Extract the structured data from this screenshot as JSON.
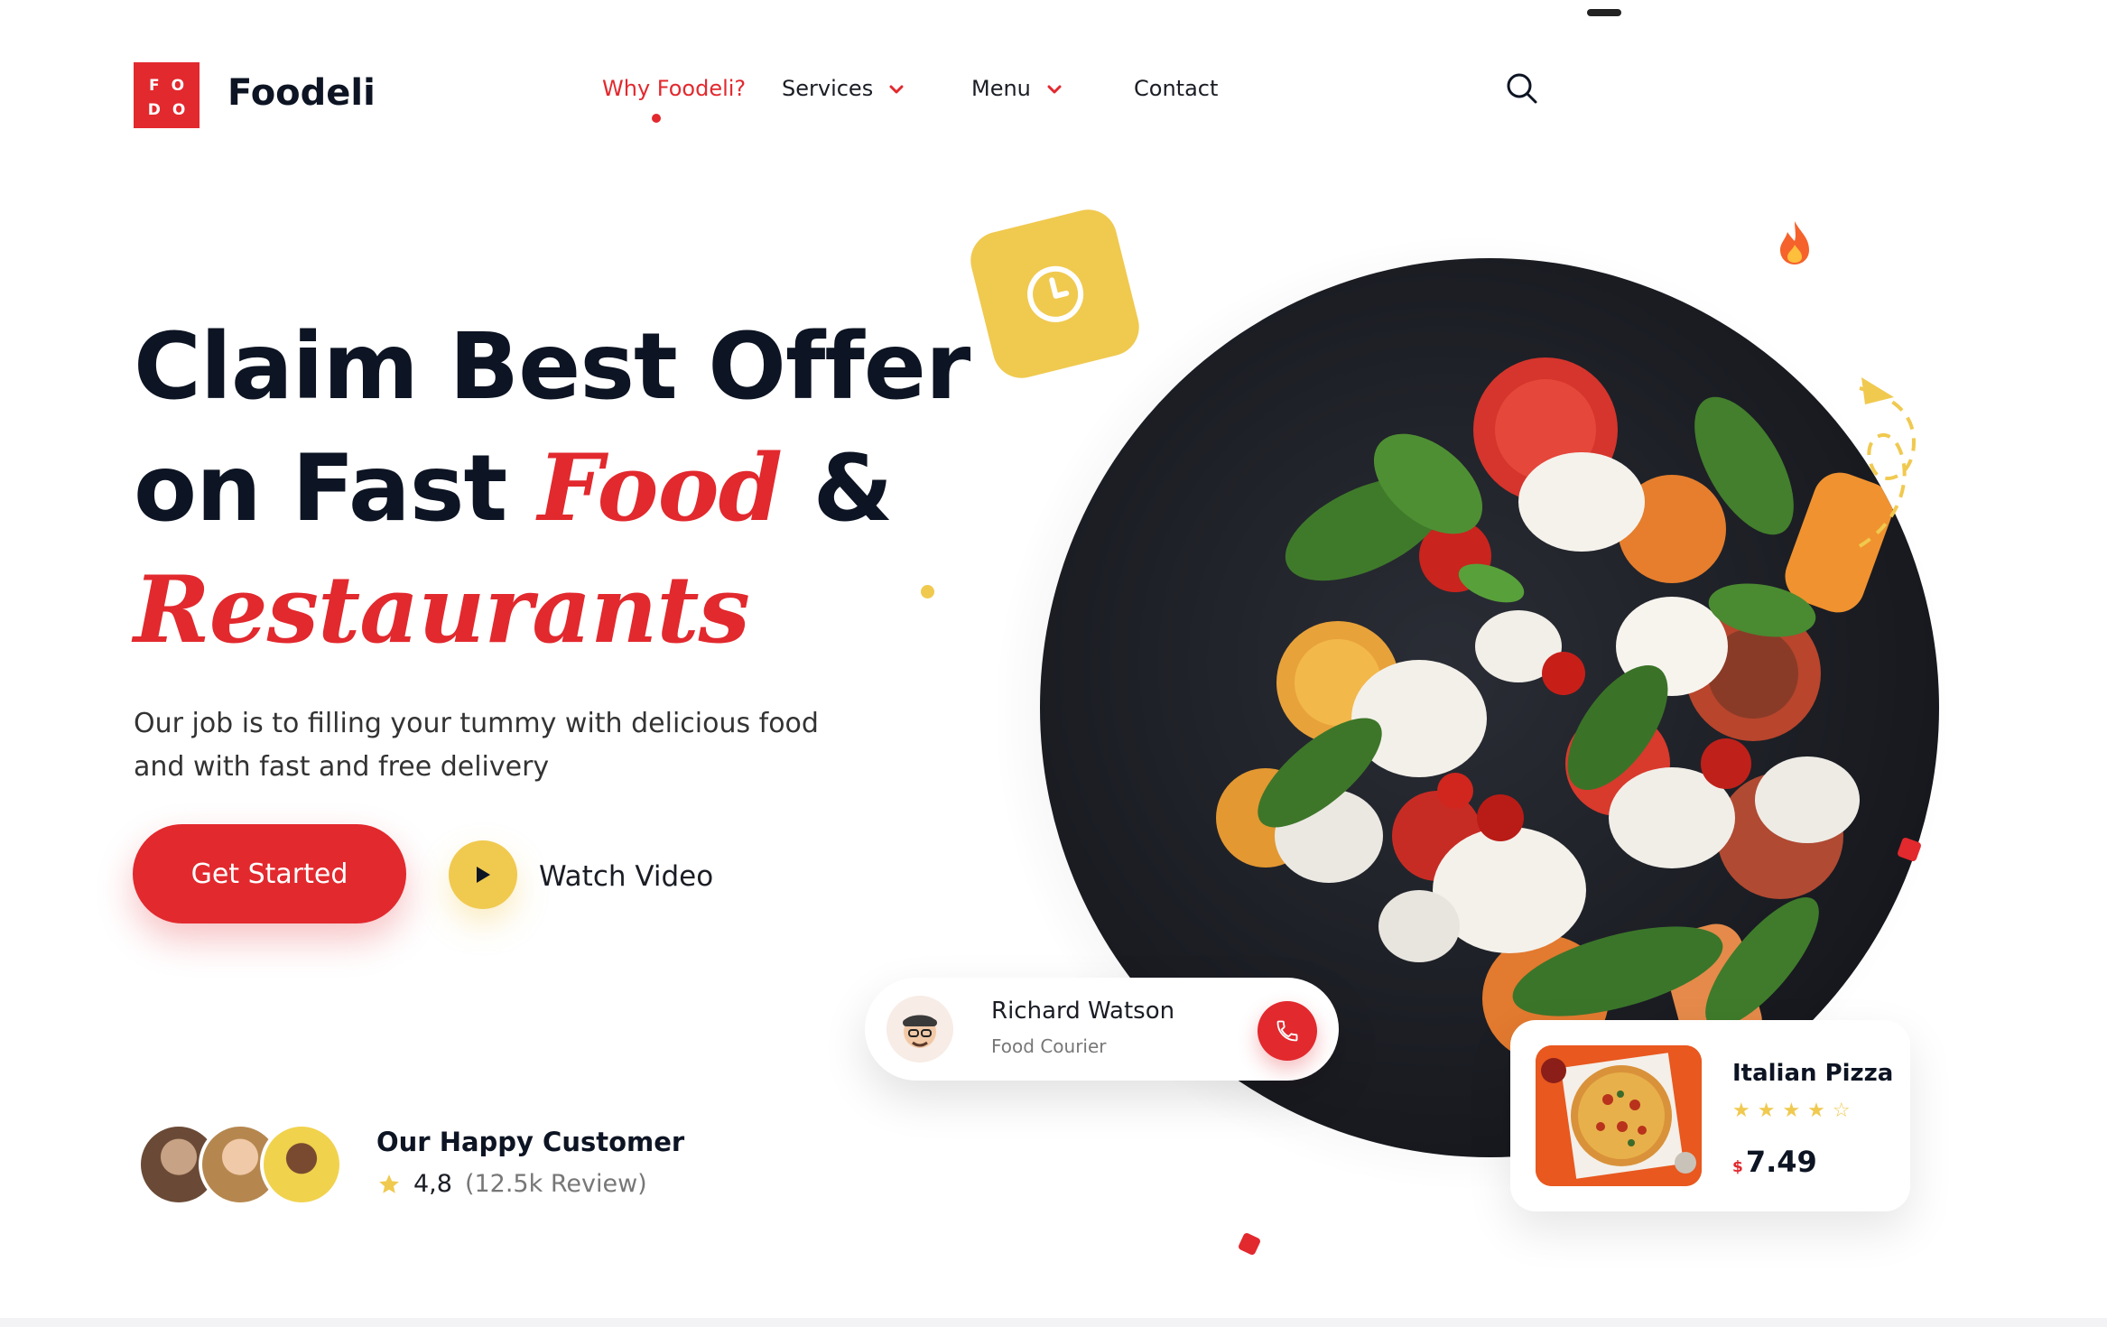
{
  "brand": {
    "logo_letters_top": "FO",
    "logo_letters_bottom": "DO",
    "name": "Foodeli"
  },
  "nav": {
    "items": [
      {
        "label": "Why Foodeli?",
        "active": true
      },
      {
        "label": "Services",
        "dropdown": true
      },
      {
        "label": "Menu",
        "dropdown": true
      },
      {
        "label": "Contact"
      }
    ],
    "search_icon": "search-icon"
  },
  "hero": {
    "line1": "Claim Best Offer",
    "line2_prefix": "on Fast ",
    "line2_highlight": "Food",
    "line2_suffix": " &",
    "line3_highlight": "Restaurants",
    "description_line1": "Our job is to filling your tummy with delicious food",
    "description_line2": "and  with fast and free delivery",
    "cta_label": "Get Started",
    "video_label": "Watch Video"
  },
  "customers": {
    "title": "Our Happy Customer",
    "rating": "4,8",
    "reviews": "(12.5k Review)"
  },
  "courier": {
    "name": "Richard Watson",
    "role": "Food Courier"
  },
  "product": {
    "name": "Italian Pizza",
    "stars": "★★★★☆",
    "rating_value": 4,
    "currency": "$",
    "price": "7.49"
  },
  "colors": {
    "accent_red": "#e2292e",
    "accent_yellow": "#f0c94f",
    "text_dark": "#0d1423"
  }
}
